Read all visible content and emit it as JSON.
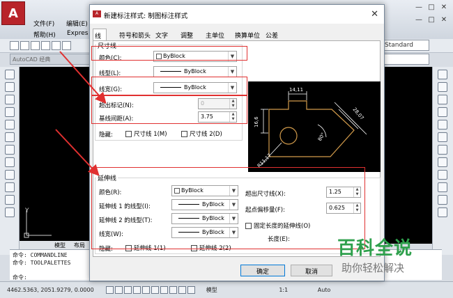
{
  "app": {
    "logo": "A",
    "menu": [
      "文件(F)",
      "编辑(E)"
    ],
    "menu_row2": [
      "帮助(H)",
      "Expres"
    ],
    "workspace": "AutoCAD 经典",
    "style_combo": "Standard",
    "win_controls": [
      "—",
      "□",
      "✕"
    ],
    "inner_controls": [
      "—",
      "□",
      "✕"
    ]
  },
  "dialog": {
    "title": "新建标注样式: 制图标注样式",
    "close": "✕",
    "tabs": [
      "线",
      "符号和箭头",
      "文字",
      "调整",
      "主单位",
      "换算单位",
      "公差"
    ],
    "dim_lines": {
      "title": "尺寸线",
      "color_label": "颜色(C):",
      "color_value": "ByBlock",
      "linetype_label": "线型(L):",
      "linetype_value": "ByBlock",
      "lineweight_label": "线宽(G):",
      "lineweight_value": "ByBlock",
      "extend_label": "超出标记(N):",
      "extend_value": "0",
      "baseline_label": "基线间距(A):",
      "baseline_value": "3.75",
      "suppress_label": "隐藏:",
      "suppress_1": "尺寸线 1(M)",
      "suppress_2": "尺寸线 2(D)"
    },
    "ext_lines": {
      "title": "延伸线",
      "color_label": "颜色(R):",
      "color_value": "ByBlock",
      "lt1_label": "延伸线 1 的线型(I):",
      "lt1_value": "ByBlock",
      "lt2_label": "延伸线 2 的线型(T):",
      "lt2_value": "ByBlock",
      "lw_label": "线宽(W):",
      "lw_value": "ByBlock",
      "suppress_label": "隐藏:",
      "suppress_1": "延伸线 1(1)",
      "suppress_2": "延伸线 2(2)",
      "beyond_label": "超出尺寸线(X):",
      "beyond_value": "1.25",
      "offset_label": "起点偏移量(F):",
      "offset_value": "0.625",
      "fixed_label": "固定长度的延伸线(O)",
      "length_label": "长度(E):"
    },
    "preview": {
      "dim_top": "14,11",
      "dim_left": "16,6",
      "dim_right": "28,07",
      "dim_angle": "80°",
      "dim_radius": "R11,17"
    },
    "ok": "确定",
    "cancel": "取消"
  },
  "command": {
    "lines": [
      "命令: COMMANDLINE",
      "命令: TOOLPALETTES"
    ],
    "prompt": "命令:"
  },
  "status": {
    "coords": "4462.5363, 2051.9279, 0.0000",
    "model": "模型",
    "scale": "1:1",
    "auto": "Auto"
  },
  "layout_tabs": [
    "模型",
    "布局"
  ],
  "watermark": {
    "main": "百科全说",
    "sub": "助你轻松解决"
  },
  "colors": {
    "highlight": "#e03030",
    "arrow": "#e03030",
    "preview_dims": "#ffffff",
    "preview_part": "#d29b4b"
  }
}
